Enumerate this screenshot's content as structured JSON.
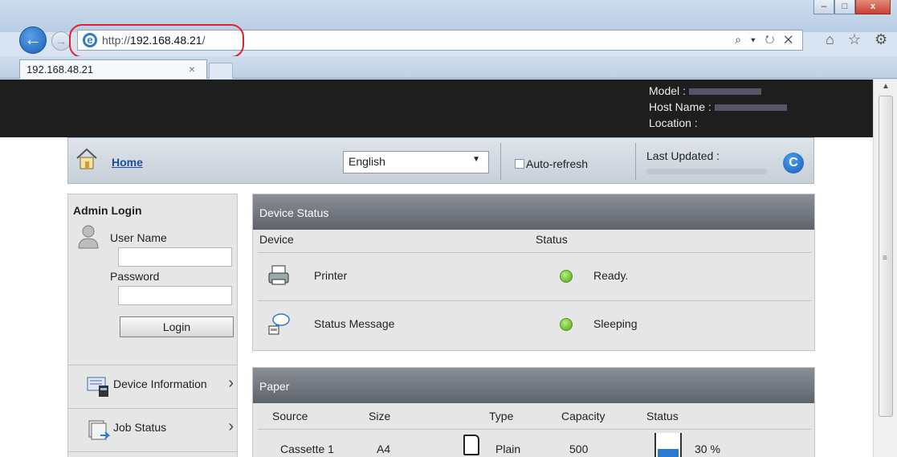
{
  "browser": {
    "url_prefix": "http://",
    "url_host": "192.168.48.21",
    "url_suffix": "/",
    "tab_title": "192.168.48.21",
    "tab_close": "×",
    "window_buttons": {
      "minimize": "–",
      "maximize": "□",
      "close": "x"
    },
    "address_tools": "⌕ ▾ ↻ ✕",
    "right_icons": "⌂ ☆ ⚙"
  },
  "device_header": {
    "model_label": "Model :",
    "host_label": "Host Name :",
    "location_label": "Location :"
  },
  "toolbar": {
    "home_label": "Home",
    "language": "English",
    "auto_refresh_label": "Auto-refresh",
    "auto_refresh_checked": false,
    "last_updated_label": "Last Updated :"
  },
  "admin_login": {
    "title": "Admin Login",
    "user_label": "User Name",
    "user_value": "",
    "password_label": "Password",
    "password_value": "",
    "login_button": "Login"
  },
  "nav": {
    "items": [
      {
        "label": "Device Information",
        "icon": "device-info-icon"
      },
      {
        "label": "Job Status",
        "icon": "job-status-icon"
      }
    ]
  },
  "device_status": {
    "title": "Device Status",
    "columns": [
      "Device",
      "Status"
    ],
    "rows": [
      {
        "device": "Printer",
        "status": "Ready.",
        "icon": "printer-icon",
        "status_color": "#5cb82a"
      },
      {
        "device": "Status Message",
        "status": "Sleeping",
        "icon": "status-message-icon",
        "status_color": "#5cb82a"
      }
    ]
  },
  "paper": {
    "title": "Paper",
    "columns": [
      "Source",
      "Size",
      "Type",
      "Capacity",
      "Status"
    ],
    "rows": [
      {
        "source": "Cassette 1",
        "size": "A4",
        "type": "Plain",
        "capacity": "500",
        "status": "30 %",
        "level": 0.3
      }
    ]
  },
  "colors": {
    "accent": "#1a4f9e",
    "header_dark": "#1e1e1e",
    "highlight_red": "#e0242b",
    "status_green": "#5cb82a"
  }
}
